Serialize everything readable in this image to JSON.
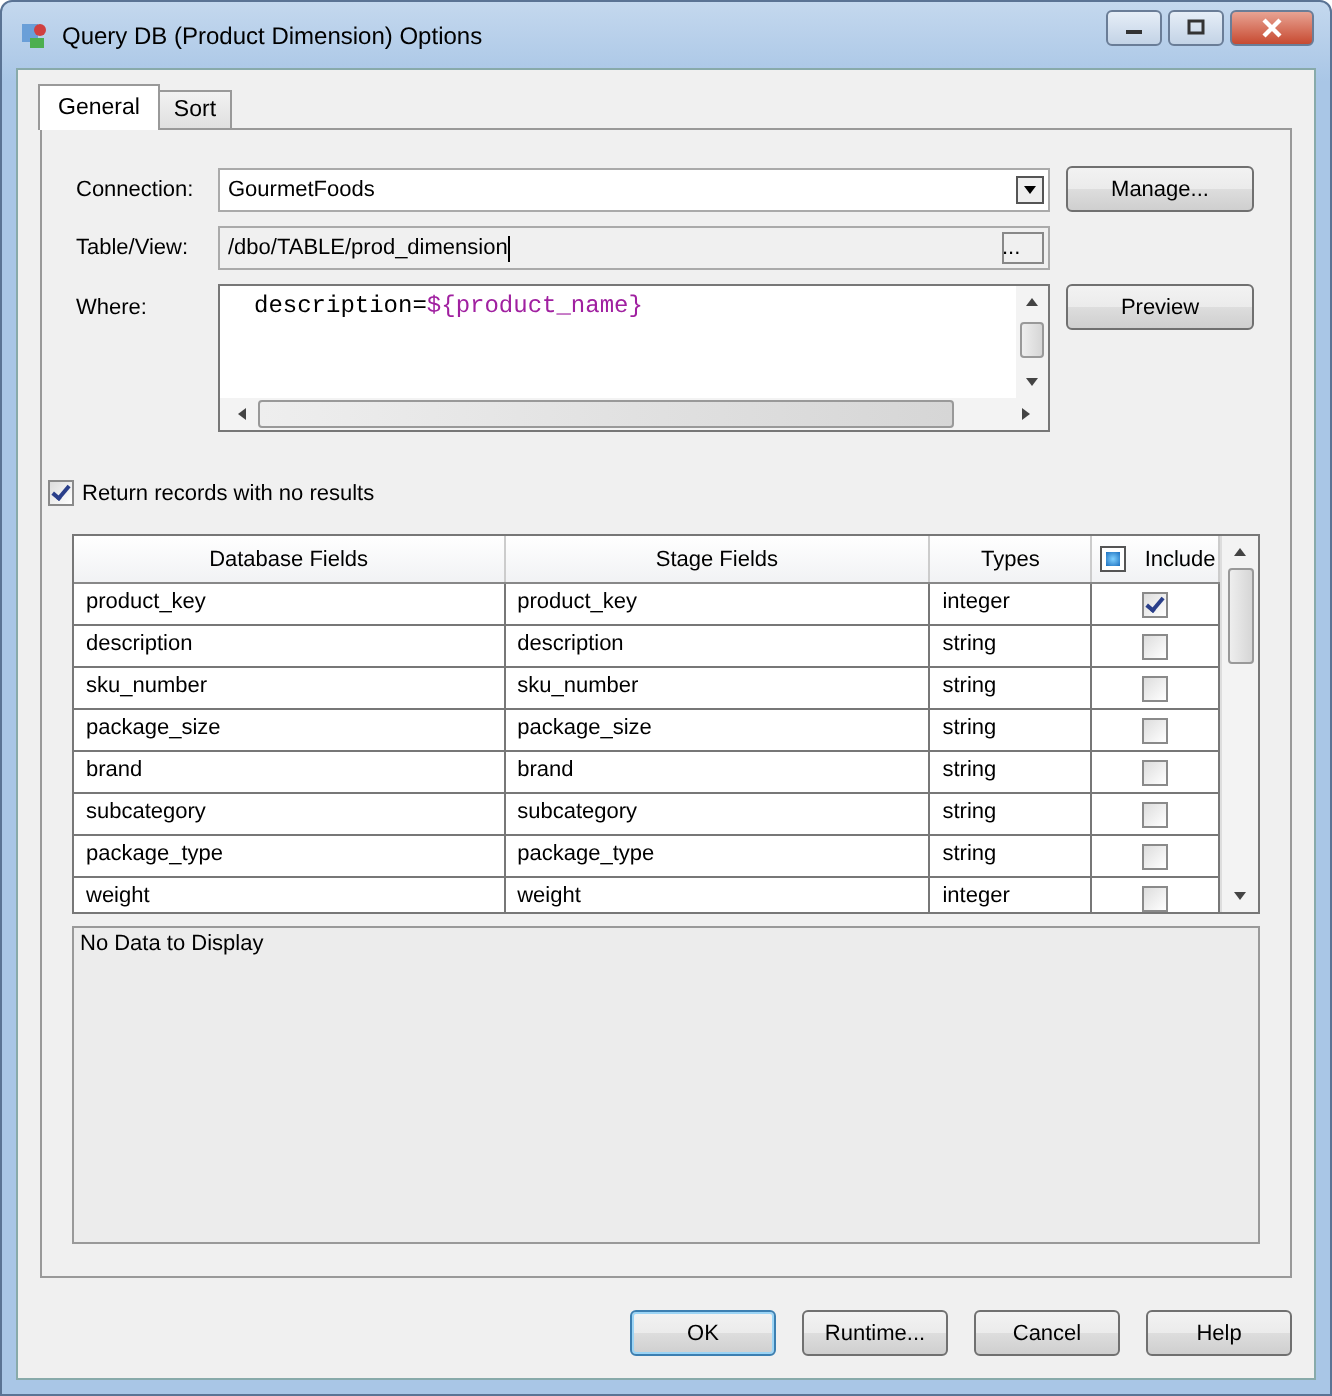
{
  "window": {
    "title": "Query DB (Product Dimension) Options"
  },
  "tabs": [
    {
      "label": "General",
      "selected": true
    },
    {
      "label": "Sort",
      "selected": false
    }
  ],
  "connection": {
    "label": "Connection:",
    "value": "GourmetFoods",
    "button": "Manage..."
  },
  "table_view": {
    "label": "Table/View:",
    "value": "/dbo/TABLE/prod_dimension",
    "button": "..."
  },
  "where": {
    "label": "Where:",
    "code": "description=",
    "variable": "${product_name}",
    "button": "Preview"
  },
  "return_records": {
    "label": "Return records with no results",
    "checked": true
  },
  "fields_table": {
    "columns": [
      {
        "label": "Database Fields"
      },
      {
        "label": "Stage Fields"
      },
      {
        "label": "Types"
      },
      {
        "label": "Include",
        "indeterminate": true
      }
    ],
    "rows": [
      {
        "database_field": "product_key",
        "stage_field": "product_key",
        "type": "integer",
        "include": true
      },
      {
        "database_field": "description",
        "stage_field": "description",
        "type": "string",
        "include": false
      },
      {
        "database_field": "sku_number",
        "stage_field": "sku_number",
        "type": "string",
        "include": false
      },
      {
        "database_field": "package_size",
        "stage_field": "package_size",
        "type": "string",
        "include": false
      },
      {
        "database_field": "brand",
        "stage_field": "brand",
        "type": "string",
        "include": false
      },
      {
        "database_field": "subcategory",
        "stage_field": "subcategory",
        "type": "string",
        "include": false
      },
      {
        "database_field": "package_type",
        "stage_field": "package_type",
        "type": "string",
        "include": false
      },
      {
        "database_field": "weight",
        "stage_field": "weight",
        "type": "integer",
        "include": false
      }
    ]
  },
  "preview_area": {
    "message": "No Data to Display"
  },
  "buttons": [
    {
      "label": "OK",
      "kind": "default"
    },
    {
      "label": "Runtime...",
      "kind": "normal"
    },
    {
      "label": "Cancel",
      "kind": "normal"
    },
    {
      "label": "Help",
      "kind": "normal"
    }
  ]
}
